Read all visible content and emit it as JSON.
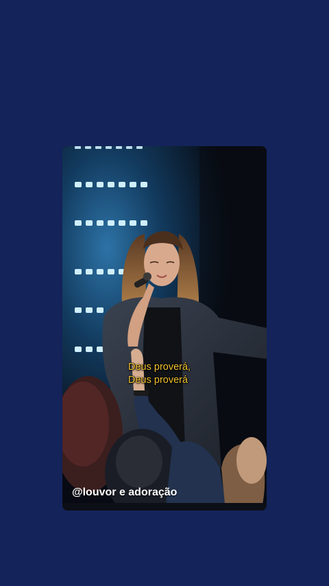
{
  "background_color": "#142359",
  "video": {
    "lyrics": {
      "line1": "Deus proverá,",
      "line2": "Deus proverá",
      "color": "#f2c230"
    },
    "watermark": "@louvor e adoração"
  }
}
